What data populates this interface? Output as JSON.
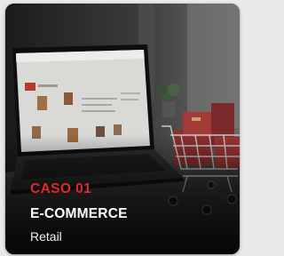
{
  "card": {
    "kicker": "CASO 01",
    "title": "E-COMMERCE",
    "subtitle": "Retail",
    "image_icon": "laptop-and-shopping-cart-photo"
  },
  "colors": {
    "accent": "#e4262e",
    "title": "#ffffff",
    "card_bg": "#1c1c1e",
    "page_bg": "#e9e9e9"
  }
}
